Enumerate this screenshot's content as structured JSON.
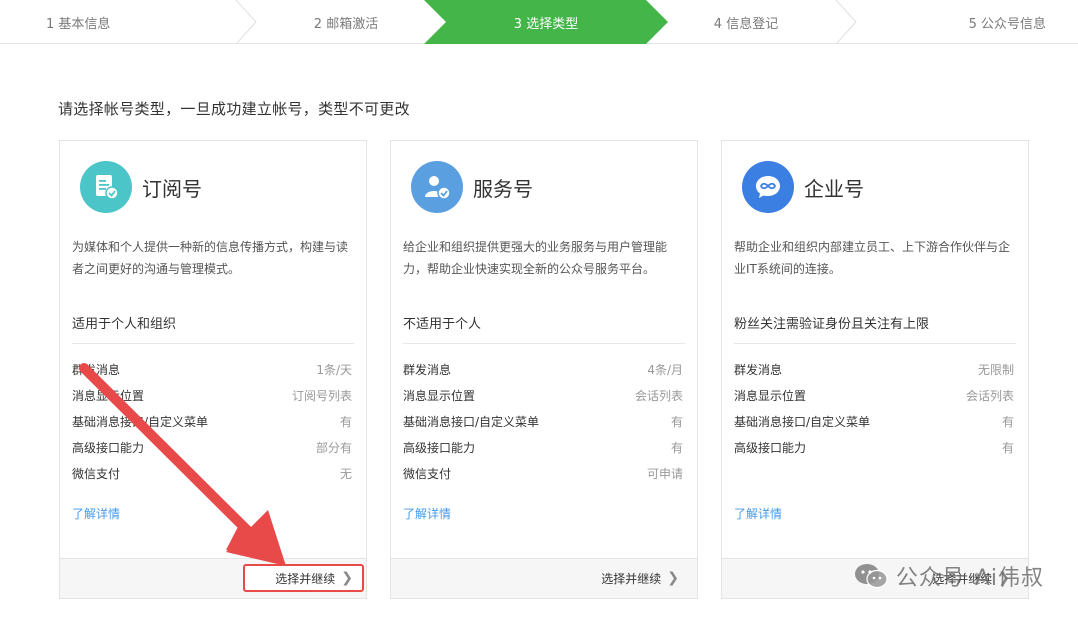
{
  "stepper": {
    "steps": [
      {
        "label": "1 基本信息"
      },
      {
        "label": "2 邮箱激活"
      },
      {
        "label": "3 选择类型"
      },
      {
        "label": "4 信息登记"
      },
      {
        "label": "5 公众号信息"
      }
    ],
    "active_index": 2,
    "active_color": "#44b549"
  },
  "instruction": "请选择帐号类型，一旦成功建立帐号，类型不可更改",
  "cards": [
    {
      "title": "订阅号",
      "icon": "document-check-icon",
      "icon_color": "#4cc5c9",
      "description": "为媒体和个人提供一种新的信息传播方式，构建与读者之间更好的沟通与管理模式。",
      "suitable": "适用于个人和组织",
      "features": [
        {
          "name": "群发消息",
          "value": "1条/天"
        },
        {
          "name": "消息显示位置",
          "value": "订阅号列表"
        },
        {
          "name": "基础消息接口/自定义菜单",
          "value": "有"
        },
        {
          "name": "高级接口能力",
          "value": "部分有"
        },
        {
          "name": "微信支付",
          "value": "无"
        }
      ],
      "details_link": "了解详情",
      "continue_label": "选择并继续"
    },
    {
      "title": "服务号",
      "icon": "person-check-icon",
      "icon_color": "#5a9fe0",
      "description": "给企业和组织提供更强大的业务服务与用户管理能力，帮助企业快速实现全新的公众号服务平台。",
      "suitable": "不适用于个人",
      "features": [
        {
          "name": "群发消息",
          "value": "4条/月"
        },
        {
          "name": "消息显示位置",
          "value": "会话列表"
        },
        {
          "name": "基础消息接口/自定义菜单",
          "value": "有"
        },
        {
          "name": "高级接口能力",
          "value": "有"
        },
        {
          "name": "微信支付",
          "value": "可申请"
        }
      ],
      "details_link": "了解详情",
      "continue_label": "选择并继续"
    },
    {
      "title": "企业号",
      "icon": "infinity-chat-icon",
      "icon_color": "#3b7fe3",
      "description": "帮助企业和组织内部建立员工、上下游合作伙伴与企业IT系统间的连接。",
      "suitable": "粉丝关注需验证身份且关注有上限",
      "features": [
        {
          "name": "群发消息",
          "value": "无限制"
        },
        {
          "name": "消息显示位置",
          "value": "会话列表"
        },
        {
          "name": "基础消息接口/自定义菜单",
          "value": "有"
        },
        {
          "name": "高级接口能力",
          "value": "有"
        }
      ],
      "details_link": "了解详情",
      "continue_label": "选择并继续"
    }
  ],
  "watermark": {
    "brand": "公众号",
    "name": "Ai伟叔"
  },
  "colors": {
    "link": "#459ae9",
    "highlight_red": "#e84a4a"
  }
}
